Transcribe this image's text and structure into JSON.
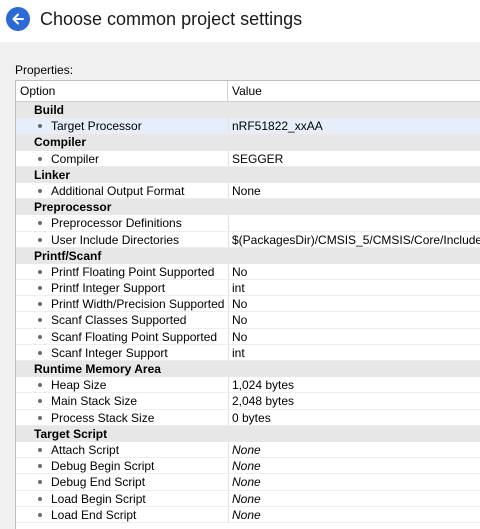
{
  "header": {
    "title": "Choose common project settings"
  },
  "properties_label": "Properties:",
  "columns": {
    "option": "Option",
    "value": "Value"
  },
  "groups": [
    {
      "name": "Build",
      "items": [
        {
          "option": "Target Processor",
          "value": "nRF51822_xxAA",
          "selected": true
        }
      ]
    },
    {
      "name": "Compiler",
      "items": [
        {
          "option": "Compiler",
          "value": "SEGGER"
        }
      ]
    },
    {
      "name": "Linker",
      "items": [
        {
          "option": "Additional Output Format",
          "value": "None"
        }
      ]
    },
    {
      "name": "Preprocessor",
      "items": [
        {
          "option": "Preprocessor Definitions",
          "value": ""
        },
        {
          "option": "User Include Directories",
          "value": "$(PackagesDir)/CMSIS_5/CMSIS/Core/Include"
        }
      ]
    },
    {
      "name": "Printf/Scanf",
      "items": [
        {
          "option": "Printf Floating Point Supported",
          "value": "No"
        },
        {
          "option": "Printf Integer Support",
          "value": "int"
        },
        {
          "option": "Printf Width/Precision Supported",
          "value": "No"
        },
        {
          "option": "Scanf Classes Supported",
          "value": "No"
        },
        {
          "option": "Scanf Floating Point Supported",
          "value": "No"
        },
        {
          "option": "Scanf Integer Support",
          "value": "int"
        }
      ]
    },
    {
      "name": "Runtime Memory Area",
      "items": [
        {
          "option": "Heap Size",
          "value": "1,024 bytes"
        },
        {
          "option": "Main Stack Size",
          "value": "2,048 bytes"
        },
        {
          "option": "Process Stack Size",
          "value": "0 bytes"
        }
      ]
    },
    {
      "name": "Target Script",
      "items": [
        {
          "option": "Attach Script",
          "value": "None",
          "italic": true
        },
        {
          "option": "Debug Begin Script",
          "value": "None",
          "italic": true
        },
        {
          "option": "Debug End Script",
          "value": "None",
          "italic": true
        },
        {
          "option": "Load Begin Script",
          "value": "None",
          "italic": true
        },
        {
          "option": "Load End Script",
          "value": "None",
          "italic": true
        }
      ]
    }
  ]
}
